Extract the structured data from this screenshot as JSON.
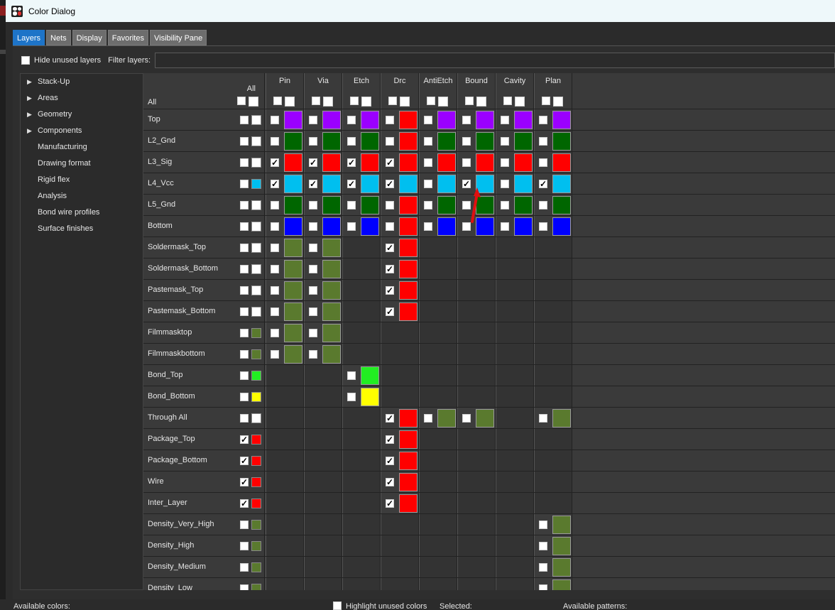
{
  "window": {
    "title": "Color Dialog"
  },
  "tabs": [
    {
      "label": "Layers",
      "active": true
    },
    {
      "label": "Nets"
    },
    {
      "label": "Display"
    },
    {
      "label": "Favorites"
    },
    {
      "label": "Visibility Pane"
    }
  ],
  "filter": {
    "hide_unused_label": "Hide unused layers",
    "filter_label": "Filter layers:",
    "filter_value": ""
  },
  "tree": [
    {
      "label": "Stack-Up",
      "expandable": true
    },
    {
      "label": "Areas",
      "expandable": true
    },
    {
      "label": "Geometry",
      "expandable": true
    },
    {
      "label": "Components",
      "expandable": true
    },
    {
      "label": "Manufacturing"
    },
    {
      "label": "Drawing format"
    },
    {
      "label": "Rigid flex"
    },
    {
      "label": "Analysis"
    },
    {
      "label": "Bond wire profiles"
    },
    {
      "label": "Surface finishes"
    }
  ],
  "grid": {
    "all_col_label": "All",
    "all_row_label": "All",
    "columns": [
      "Pin",
      "Via",
      "Etch",
      "Drc",
      "AntiEtch",
      "Bound",
      "Cavity",
      "Plan"
    ],
    "colors": {
      "purple": "#9b00ff",
      "green": "#006600",
      "red": "#ff0000",
      "cyan": "#00bfef",
      "blue": "#0000ff",
      "olive": "#5a7a2e",
      "lime": "#22ee22",
      "yellow": "#ffff00",
      "white": "#ffffff"
    },
    "rows": [
      {
        "name": "Top",
        "all_checked": false,
        "all_color": "white",
        "cells": [
          [
            0,
            "purple"
          ],
          [
            0,
            "purple"
          ],
          [
            0,
            "purple"
          ],
          [
            0,
            "red"
          ],
          [
            0,
            "purple"
          ],
          [
            0,
            "purple"
          ],
          [
            0,
            "purple"
          ],
          [
            0,
            "purple"
          ]
        ]
      },
      {
        "name": "L2_Gnd",
        "all_checked": false,
        "all_color": "white",
        "cells": [
          [
            0,
            "green"
          ],
          [
            0,
            "green"
          ],
          [
            0,
            "green"
          ],
          [
            0,
            "red"
          ],
          [
            0,
            "green"
          ],
          [
            0,
            "green"
          ],
          [
            0,
            "green"
          ],
          [
            0,
            "green"
          ]
        ]
      },
      {
        "name": "L3_Sig",
        "all_checked": false,
        "all_color": "white",
        "cells": [
          [
            1,
            "red"
          ],
          [
            1,
            "red"
          ],
          [
            1,
            "red"
          ],
          [
            1,
            "red"
          ],
          [
            0,
            "red"
          ],
          [
            0,
            "red"
          ],
          [
            0,
            "red"
          ],
          [
            0,
            "red"
          ]
        ]
      },
      {
        "name": "L4_Vcc",
        "all_checked": false,
        "all_color": "cyan",
        "cells": [
          [
            1,
            "cyan"
          ],
          [
            1,
            "cyan"
          ],
          [
            1,
            "cyan"
          ],
          [
            1,
            "cyan"
          ],
          [
            0,
            "cyan"
          ],
          [
            1,
            "cyan"
          ],
          [
            0,
            "cyan"
          ],
          [
            1,
            "cyan"
          ]
        ]
      },
      {
        "name": "L5_Gnd",
        "all_checked": false,
        "all_color": "white",
        "cells": [
          [
            0,
            "green"
          ],
          [
            0,
            "green"
          ],
          [
            0,
            "green"
          ],
          [
            0,
            "red"
          ],
          [
            0,
            "green"
          ],
          [
            0,
            "green"
          ],
          [
            0,
            "green"
          ],
          [
            0,
            "green"
          ]
        ]
      },
      {
        "name": "Bottom",
        "all_checked": false,
        "all_color": "white",
        "cells": [
          [
            0,
            "blue"
          ],
          [
            0,
            "blue"
          ],
          [
            0,
            "blue"
          ],
          [
            0,
            "red"
          ],
          [
            0,
            "blue"
          ],
          [
            0,
            "blue"
          ],
          [
            0,
            "blue"
          ],
          [
            0,
            "blue"
          ]
        ]
      },
      {
        "name": "Soldermask_Top",
        "all_checked": false,
        "all_color": "white",
        "cells": [
          [
            0,
            "olive"
          ],
          [
            0,
            "olive"
          ],
          null,
          [
            1,
            "red"
          ],
          null,
          null,
          null,
          null
        ]
      },
      {
        "name": "Soldermask_Bottom",
        "all_checked": false,
        "all_color": "white",
        "cells": [
          [
            0,
            "olive"
          ],
          [
            0,
            "olive"
          ],
          null,
          [
            1,
            "red"
          ],
          null,
          null,
          null,
          null
        ]
      },
      {
        "name": "Pastemask_Top",
        "all_checked": false,
        "all_color": "white",
        "cells": [
          [
            0,
            "olive"
          ],
          [
            0,
            "olive"
          ],
          null,
          [
            1,
            "red"
          ],
          null,
          null,
          null,
          null
        ]
      },
      {
        "name": "Pastemask_Bottom",
        "all_checked": false,
        "all_color": "white",
        "cells": [
          [
            0,
            "olive"
          ],
          [
            0,
            "olive"
          ],
          null,
          [
            1,
            "red"
          ],
          null,
          null,
          null,
          null
        ]
      },
      {
        "name": "Filmmasktop",
        "all_checked": false,
        "all_color": "olive",
        "cells": [
          [
            0,
            "olive"
          ],
          [
            0,
            "olive"
          ],
          null,
          null,
          null,
          null,
          null,
          null
        ]
      },
      {
        "name": "Filmmaskbottom",
        "all_checked": false,
        "all_color": "olive",
        "cells": [
          [
            0,
            "olive"
          ],
          [
            0,
            "olive"
          ],
          null,
          null,
          null,
          null,
          null,
          null
        ]
      },
      {
        "name": "Bond_Top",
        "all_checked": false,
        "all_color": "lime",
        "cells": [
          null,
          null,
          [
            0,
            "lime"
          ],
          null,
          null,
          null,
          null,
          null
        ]
      },
      {
        "name": "Bond_Bottom",
        "all_checked": false,
        "all_color": "yellow",
        "cells": [
          null,
          null,
          [
            0,
            "yellow"
          ],
          null,
          null,
          null,
          null,
          null
        ]
      },
      {
        "name": "Through All",
        "all_checked": false,
        "all_color": "white",
        "cells": [
          null,
          null,
          null,
          [
            1,
            "red"
          ],
          [
            0,
            "olive"
          ],
          [
            0,
            "olive"
          ],
          null,
          [
            0,
            "olive"
          ]
        ]
      },
      {
        "name": "Package_Top",
        "all_checked": true,
        "all_color": "red",
        "cells": [
          null,
          null,
          null,
          [
            1,
            "red"
          ],
          null,
          null,
          null,
          null
        ]
      },
      {
        "name": "Package_Bottom",
        "all_checked": true,
        "all_color": "red",
        "cells": [
          null,
          null,
          null,
          [
            1,
            "red"
          ],
          null,
          null,
          null,
          null
        ]
      },
      {
        "name": "Wire",
        "all_checked": true,
        "all_color": "red",
        "cells": [
          null,
          null,
          null,
          [
            1,
            "red"
          ],
          null,
          null,
          null,
          null
        ]
      },
      {
        "name": "Inter_Layer",
        "all_checked": true,
        "all_color": "red",
        "cells": [
          null,
          null,
          null,
          [
            1,
            "red"
          ],
          null,
          null,
          null,
          null
        ]
      },
      {
        "name": "Density_Very_High",
        "all_checked": false,
        "all_color": "olive",
        "cells": [
          null,
          null,
          null,
          null,
          null,
          null,
          null,
          [
            0,
            "olive"
          ]
        ]
      },
      {
        "name": "Density_High",
        "all_checked": false,
        "all_color": "olive",
        "cells": [
          null,
          null,
          null,
          null,
          null,
          null,
          null,
          [
            0,
            "olive"
          ]
        ]
      },
      {
        "name": "Density_Medium",
        "all_checked": false,
        "all_color": "olive",
        "cells": [
          null,
          null,
          null,
          null,
          null,
          null,
          null,
          [
            0,
            "olive"
          ]
        ]
      },
      {
        "name": "Density_Low",
        "all_checked": false,
        "all_color": "olive",
        "cells": [
          null,
          null,
          null,
          null,
          null,
          null,
          null,
          [
            0,
            "olive"
          ]
        ]
      }
    ]
  },
  "bottom": {
    "available_colors": "Available colors:",
    "highlight_unused": "Highlight unused colors",
    "selected": "Selected:",
    "available_patterns": "Available patterns:"
  }
}
